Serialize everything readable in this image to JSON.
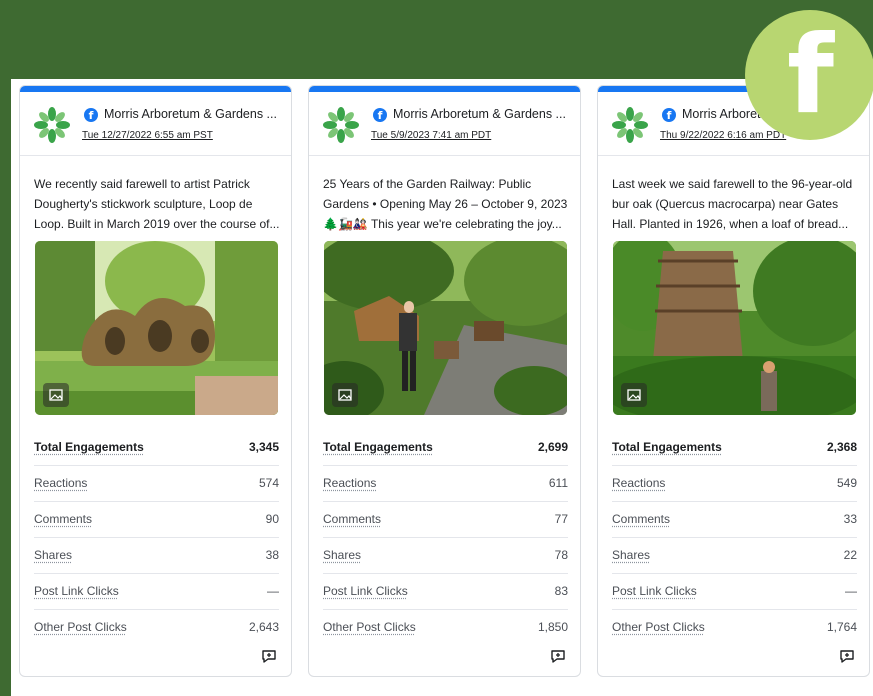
{
  "brand": {
    "corner_icon": "facebook-logo",
    "corner_letter": "f",
    "accent": "#1877f2",
    "bg": "#3e6a31",
    "corner_bg": "#b8d671"
  },
  "metric_labels": {
    "total": "Total Engagements",
    "reactions": "Reactions",
    "comments": "Comments",
    "shares": "Shares",
    "link_clicks": "Post Link Clicks",
    "other_clicks": "Other Post Clicks"
  },
  "cards": [
    {
      "page_name": "Morris Arboretum & Gardens ...",
      "date": "Tue 12/27/2022 6:55 am PST",
      "text": "We recently said farewell to artist Patrick Dougherty's stickwork sculpture, Loop de Loop. Built in March 2019 over the course of...",
      "image_icon": "image-icon",
      "total": "3,345",
      "reactions": "574",
      "comments": "90",
      "shares": "38",
      "link_clicks": "—",
      "other_clicks": "2,643"
    },
    {
      "page_name": "Morris Arboretum & Gardens ...",
      "date": "Tue 5/9/2023 7:41 am PDT",
      "text": "25 Years of the Garden Railway: Public Gardens • Opening May 26 – October 9, 2023 🌲🚂🎎 This year we're celebrating the joy...",
      "image_icon": "image-icon",
      "total": "2,699",
      "reactions": "611",
      "comments": "77",
      "shares": "78",
      "link_clicks": "83",
      "other_clicks": "1,850"
    },
    {
      "page_name": "Morris Arboretum & Gardens ...",
      "date": "Thu 9/22/2022 6:16 am PDT",
      "text": "Last week we said farewell to the 96-year-old bur oak (Quercus macrocarpa) near Gates Hall. Planted in 1926, when a loaf of bread...",
      "image_icon": "image-icon",
      "total": "2,368",
      "reactions": "549",
      "comments": "33",
      "shares": "22",
      "link_clicks": "—",
      "other_clicks": "1,764"
    }
  ]
}
